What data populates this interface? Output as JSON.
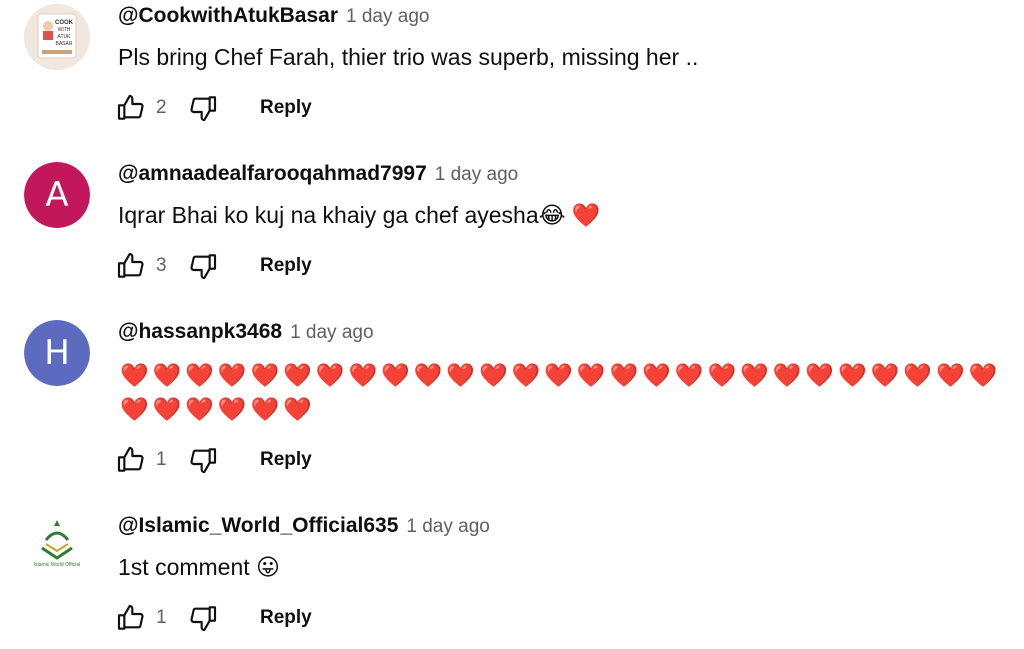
{
  "comments": [
    {
      "author": "@CookwithAtukBasar",
      "time": "1 day ago",
      "text": "Pls bring Chef Farah, thier trio was superb, missing her ..",
      "likes": "2",
      "reply_label": "Reply",
      "avatar_logo_text": "COOK WITH ATUK BASAR"
    },
    {
      "author": "@amnaadealfarooqahmad7997",
      "time": "1 day ago",
      "text": "Iqrar Bhai ko kuj na khaiy ga chef ayesha😂 ❤️",
      "likes": "3",
      "reply_label": "Reply",
      "avatar_letter": "A",
      "avatar_color": "#c2185b"
    },
    {
      "author": "@hassanpk3468",
      "time": "1 day ago",
      "text": "❤️❤️❤️❤️❤️❤️❤️❤️❤️❤️❤️❤️❤️❤️❤️❤️❤️❤️❤️❤️❤️❤️❤️❤️❤️❤️❤️❤️❤️❤️❤️❤️❤️",
      "likes": "1",
      "reply_label": "Reply",
      "avatar_letter": "H",
      "avatar_color": "#5c6bc0"
    },
    {
      "author": "@Islamic_World_Official635",
      "time": "1 day ago",
      "text": "1st comment 😛",
      "likes": "1",
      "reply_label": "Reply",
      "avatar_logo_text": "Islamic World Official"
    }
  ],
  "icons": {
    "like": "thumbs-up-icon",
    "dislike": "thumbs-down-icon"
  }
}
